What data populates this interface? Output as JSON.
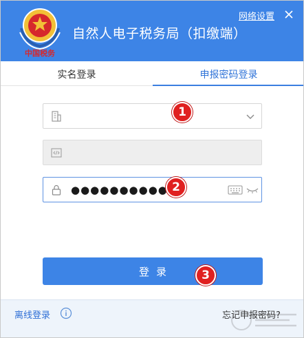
{
  "window": {
    "title": "自然人电子税务局（扣缴端）",
    "network_settings": "网络设置",
    "logo_text": "中国税务"
  },
  "tabs": [
    {
      "label": "实名登录",
      "active": false
    },
    {
      "label": "申报密码登录",
      "active": true
    }
  ],
  "form": {
    "user_value": "",
    "code_value": "",
    "password_mask": "●●●●●●●●●●●"
  },
  "annotations": [
    "1",
    "2",
    "3"
  ],
  "actions": {
    "login_label": "登录"
  },
  "footer": {
    "offline_login": "离线登录",
    "forgot_password": "忘记申报密码?"
  },
  "colors": {
    "accent": "#3d84e6",
    "badge": "#e02020",
    "footer_bg": "#eef4fb"
  }
}
